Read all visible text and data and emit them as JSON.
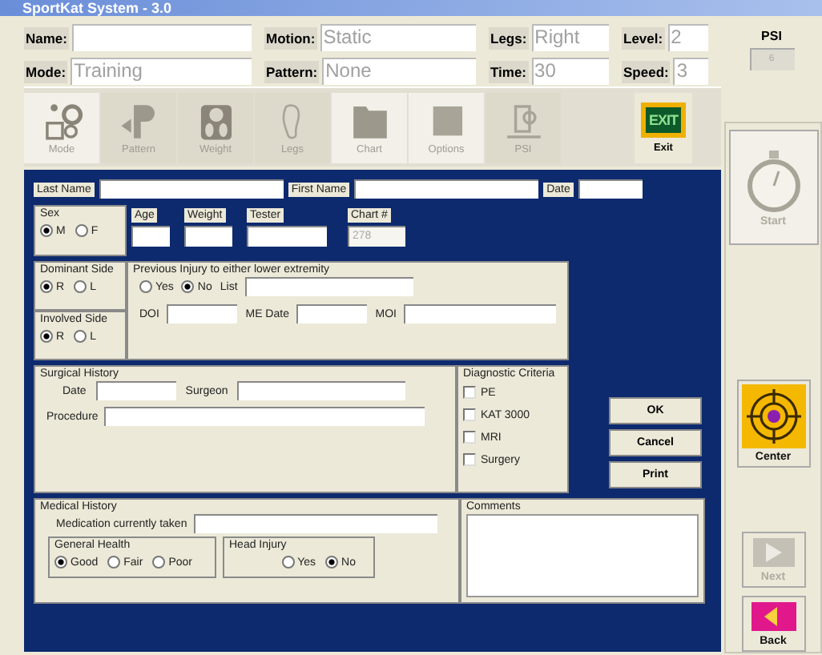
{
  "window": {
    "title": "SportKat System - 3.0"
  },
  "session": [
    {
      "label": "Name:"
    },
    {
      "label": "Motion:",
      "value": "Static"
    },
    {
      "label": "Legs:",
      "value": "Right"
    },
    {
      "label": "Level:",
      "value": "2"
    },
    {
      "label": "Mode:",
      "value": "Training"
    },
    {
      "label": "Pattern:",
      "value": "None"
    },
    {
      "label": "Time:",
      "value": "30"
    },
    {
      "label": "Speed:",
      "value": "3"
    }
  ],
  "psi": {
    "label": "PSI",
    "value": "6"
  },
  "toolbar": [
    {
      "label": "Mode",
      "kind": "mode"
    },
    {
      "label": "Pattern",
      "kind": "pattern"
    },
    {
      "label": "Weight",
      "kind": "weight"
    },
    {
      "label": "Legs",
      "kind": "legs"
    },
    {
      "label": "Chart",
      "kind": "chart"
    },
    {
      "label": "Options",
      "kind": "options"
    },
    {
      "label": "PSI",
      "kind": "psi"
    },
    {
      "label": "Exit",
      "kind": "exit",
      "sign": "EXIT"
    }
  ],
  "side_buttons": [
    {
      "label": "Start",
      "kind": "stopwatch",
      "disabled": true
    },
    {
      "label": "Center",
      "kind": "target",
      "disabled": false
    },
    {
      "label": "Next",
      "kind": "next",
      "disabled": true
    },
    {
      "label": "Back",
      "kind": "back",
      "disabled": false
    }
  ],
  "patient": [
    {
      "label": "Last Name"
    },
    {
      "label": "First Name"
    },
    {
      "label": "Date"
    }
  ],
  "sex": {
    "title": "Sex",
    "options": [
      {
        "label": "M",
        "selected": true
      },
      {
        "label": "F",
        "selected": false
      }
    ]
  },
  "measures": [
    {
      "label": "Age"
    },
    {
      "label": "Weight"
    },
    {
      "label": "Tester"
    },
    {
      "label": "Chart #",
      "value": "278"
    }
  ],
  "dominant_side": {
    "title": "Dominant Side",
    "options": [
      {
        "label": "R",
        "selected": true
      },
      {
        "label": "L",
        "selected": false
      }
    ]
  },
  "involved_side": {
    "title": "Involved Side",
    "options": [
      {
        "label": "R",
        "selected": true
      },
      {
        "label": "L",
        "selected": false
      }
    ]
  },
  "previous_injury": {
    "title": "Previous Injury to either lower extremity",
    "options": [
      {
        "label": "Yes",
        "selected": false
      },
      {
        "label": "No",
        "selected": true
      }
    ],
    "list_label": "List",
    "fields": [
      {
        "label": "DOI"
      },
      {
        "label": "ME Date"
      },
      {
        "label": "MOI"
      }
    ]
  },
  "surgical_history": {
    "title": "Surgical History",
    "date_label": "Date",
    "surgeon_label": "Surgeon",
    "procedure_label": "Procedure"
  },
  "diagnostic_criteria": {
    "title": "Diagnostic Criteria",
    "items": [
      {
        "label": "PE",
        "checked": false
      },
      {
        "label": "KAT 3000",
        "checked": false
      },
      {
        "label": "MRI",
        "checked": false
      },
      {
        "label": "Surgery",
        "checked": false
      }
    ]
  },
  "actions": [
    "OK",
    "Cancel",
    "Print"
  ],
  "medical_history": {
    "title": "Medical History",
    "medication_label": "Medication currently taken",
    "general_health": {
      "title": "General Health",
      "options": [
        {
          "label": "Good",
          "selected": true
        },
        {
          "label": "Fair",
          "selected": false
        },
        {
          "label": "Poor",
          "selected": false
        }
      ]
    },
    "head_injury": {
      "title": "Head Injury",
      "options": [
        {
          "label": "Yes",
          "selected": false
        },
        {
          "label": "No",
          "selected": true
        }
      ]
    }
  },
  "comments": {
    "title": "Comments"
  }
}
